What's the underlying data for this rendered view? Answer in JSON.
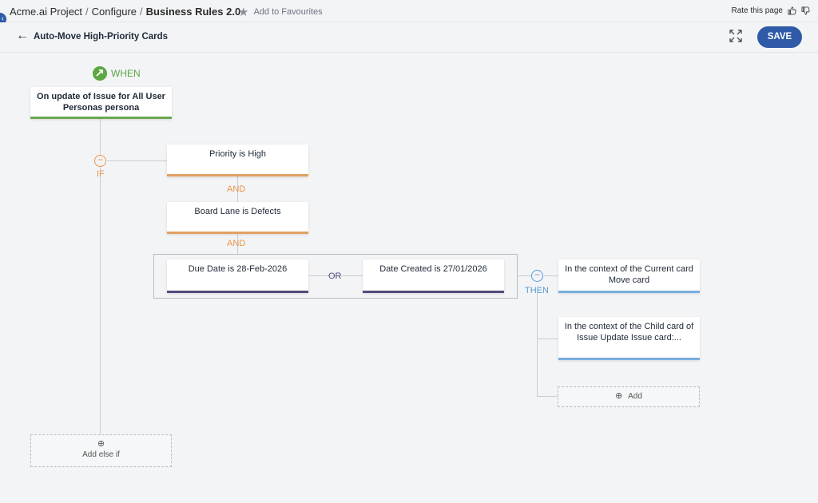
{
  "breadcrumb": {
    "items": [
      "Acme.ai Project",
      "Configure"
    ],
    "current": "Business Rules 2.0",
    "separator": "/"
  },
  "favourites_label": "Add to Favourites",
  "rate_label": "Rate this page",
  "header": {
    "title": "Auto-Move High-Priority Cards",
    "save_label": "SAVE"
  },
  "flow": {
    "when_label": "WHEN",
    "trigger": "On update of Issue for All User Personas persona",
    "if_label": "IF",
    "conditions": [
      "Priority is High",
      "Board Lane is Defects"
    ],
    "and_label": "AND",
    "or_conditions": [
      "Due Date is 28-Feb-2026",
      "Date Created is 27/01/2026"
    ],
    "or_label": "OR",
    "then_label": "THEN",
    "actions": [
      "In the context of the Current card Move card",
      "In the context of the Child card of Issue Update Issue card:..."
    ],
    "add_label": "Add",
    "add_else_if_label": "Add else if"
  },
  "colors": {
    "primary": "#2e5aa8",
    "when": "#5aa743",
    "if": "#e8954a",
    "then": "#5a9bd5",
    "or": "#544a7d"
  }
}
